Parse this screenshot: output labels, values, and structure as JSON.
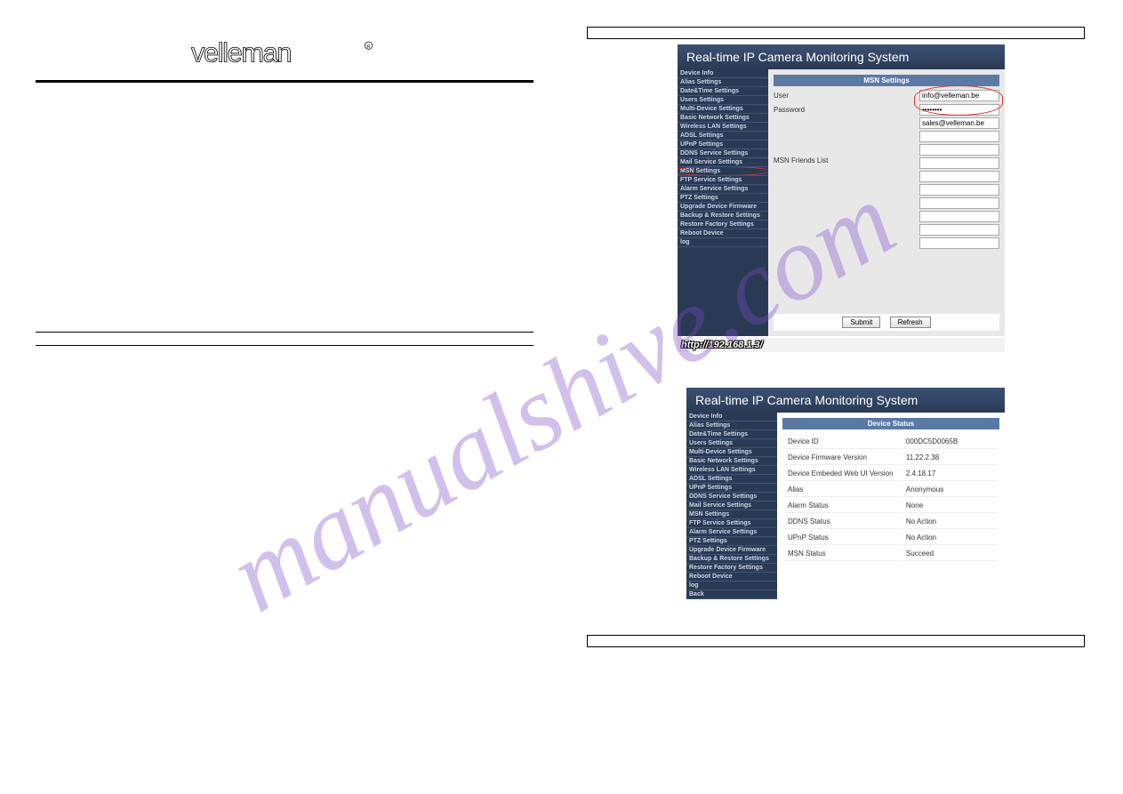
{
  "watermark": "manualshive.com",
  "logo_alt": "velleman",
  "link_text": "                    ",
  "panel1": {
    "header": "Real-time IP Camera Monitoring System",
    "sidebar": [
      "Device Info",
      "Alias Settings",
      "Date&Time Settings",
      "Users Settings",
      "Multi-Device Settings",
      "Basic Network Settings",
      "Wireless LAN Settings",
      "ADSL Settings",
      "UPnP Settings",
      "DDNS Service Settings",
      "Mail Service Settings",
      "MSN Settings",
      "FTP Service Settings",
      "Alarm Service Settings",
      "PTZ Settings",
      "Upgrade Device Firmware",
      "Backup & Restore Settings",
      "Restore Factory Settings",
      "Reboot Device",
      "log"
    ],
    "highlighted_index": 11,
    "section_title": "MSN Settings",
    "user_label": "User",
    "user_value": "info@velleman.be",
    "password_label": "Password",
    "password_value": "••••••••",
    "friends_label": "MSN Friends List",
    "friends": [
      "sales@velleman.be",
      "",
      "",
      "",
      "",
      "",
      "",
      "",
      "",
      ""
    ],
    "submit": "Submit",
    "refresh": "Refresh",
    "url": "http://192.168.1.3/"
  },
  "panel2": {
    "header": "Real-time IP Camera Monitoring System",
    "sidebar": [
      "Device Info",
      "Alias Settings",
      "Date&Time Settings",
      "Users Settings",
      "Multi-Device Settings",
      "Basic Network Settings",
      "Wireless LAN Settings",
      "ADSL Settings",
      "UPnP Settings",
      "DDNS Service Settings",
      "Mail Service Settings",
      "MSN Settings",
      "FTP Service Settings",
      "Alarm Service Settings",
      "PTZ Settings",
      "Upgrade Device Firmware",
      "Backup & Restore Settings",
      "Restore Factory Settings",
      "Reboot Device",
      "log",
      "Back"
    ],
    "section_title": "Device Status",
    "rows": [
      {
        "k": "Device ID",
        "v": "000DC5D0065B"
      },
      {
        "k": "Device Firmware Version",
        "v": "11.22.2.38"
      },
      {
        "k": "Device Embeded Web UI Version",
        "v": "2.4.18.17"
      },
      {
        "k": "Alias",
        "v": "Anonymous"
      },
      {
        "k": "Alarm Status",
        "v": "None"
      },
      {
        "k": "DDNS Status",
        "v": "No Action"
      },
      {
        "k": "UPnP Status",
        "v": "No Action"
      },
      {
        "k": "MSN Status",
        "v": "Succeed"
      }
    ]
  }
}
